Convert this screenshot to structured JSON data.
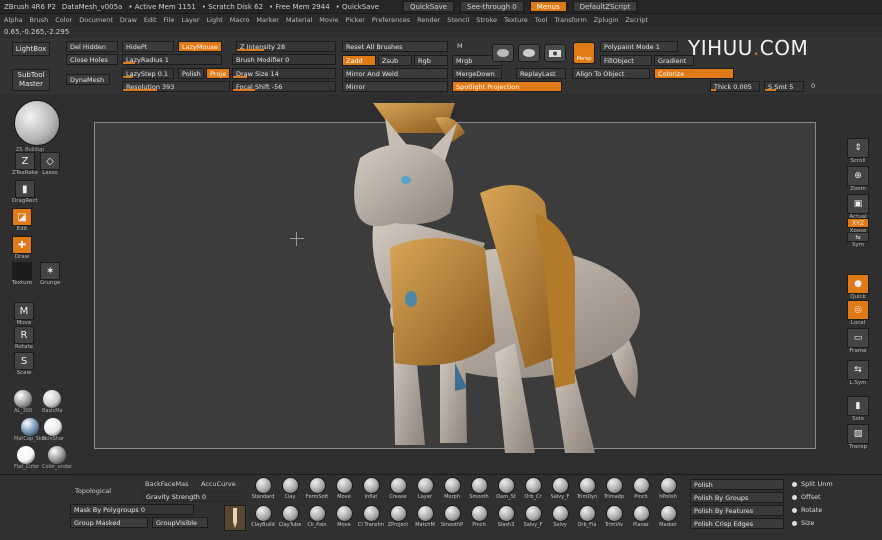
{
  "titlebar": {
    "app": "ZBrush 4R6 P2",
    "doc": "DataMesh_v005a",
    "active_mem": "• Active Mem 1151",
    "scratch": "• Scratch Disk 62",
    "free_mem": "• Free Mem 2944",
    "quicksave_label": "• QuickSave",
    "quicksave_btn": "QuickSave",
    "see_through": "See-through  0",
    "menus_btn": "Menus",
    "default_script": "DefaultZScript"
  },
  "menubar": [
    "Alpha",
    "Brush",
    "Color",
    "Document",
    "Draw",
    "Edit",
    "File",
    "Layer",
    "Light",
    "Macro",
    "Marker",
    "Material",
    "Movie",
    "Picker",
    "Preferences",
    "Render",
    "Stencil",
    "Stroke",
    "Texture",
    "Tool",
    "Transform",
    "Zplugin",
    "Zscript"
  ],
  "coords": "0.65,-0.265,-2.295",
  "watermark": {
    "pre": "YIHUU",
    "dot": ".",
    "post": "COM"
  },
  "shelf": {
    "lightbox": "LightBox",
    "subtool_master": "SubTool Master",
    "del_hidden": "Del Hidden",
    "close_holes": "Close Holes",
    "dynamesh": "DynaMesh",
    "hidept": "HidePt",
    "lazymouse": "LazyMouse",
    "lazyradius": "LazyRadius 1",
    "lazystep": "LazyStep 0.1",
    "polish": "Polish",
    "projection": "Proje",
    "resolution": "Resolution 393",
    "z_intensity": "Z Intensity 28",
    "brush_modifier": "Brush Modifier 0",
    "draw_size": "Draw Size 14",
    "focal_shift": "Focal Shift -56",
    "reset_all": "Reset All Brushes",
    "zadd": "Zadd",
    "zsub": "Zsub",
    "rgb": "Rgb",
    "mrgb": "Mrgb",
    "m": "M",
    "mirror_weld": "Mirror And Weld",
    "mergedown": "MergeDown",
    "mirror": "Mirror",
    "replaylast": "ReplayLast",
    "spotlight": "Spotlight Projection",
    "persp": "Persp",
    "polypaint_mode": "Polypaint Mode 1",
    "fillobject": "FillObject",
    "gradient": "Gradient",
    "align_object": "Align To Object",
    "colorize": "Colorize",
    "thick": "Thick 0.005",
    "s_smt": "S Smt 5",
    "s_smt_val": "0",
    "icons": [
      "Scroll",
      "Rotate",
      "Snapshot"
    ]
  },
  "left": {
    "brush_label": "ZS_Buildup",
    "tools": [
      {
        "label": "ZTexRake",
        "glyph": "Z"
      },
      {
        "label": "Lasso",
        "glyph": "◇"
      },
      {
        "label": "DragRect",
        "glyph": "▮"
      },
      {
        "label": "Edit",
        "glyph": "◪"
      },
      {
        "label": "Draw",
        "glyph": "✚"
      },
      {
        "label": "Texture",
        "glyph": ""
      },
      {
        "label": "Grunge",
        "glyph": "✶"
      },
      {
        "label": "Move",
        "glyph": "M"
      },
      {
        "label": "Rotate",
        "glyph": "R"
      },
      {
        "label": "Scale",
        "glyph": "S"
      }
    ],
    "materials": [
      {
        "label": "AL_300",
        "color": "#9a9a9a"
      },
      {
        "label": "BasicMa",
        "color": "#c9c9c9"
      },
      {
        "label": "MatCap_Skin",
        "color": "#6a8fb0"
      },
      {
        "label": "SkinShar",
        "color": "#e8e8e8"
      },
      {
        "label": "Flat_Color",
        "color": "#f5f5f5"
      },
      {
        "label": "Color_under",
        "color": "#8f8f8f"
      }
    ],
    "swatch_primary": "#e6c790",
    "swatch_secondary": "#e6e6e6"
  },
  "right": {
    "tools": [
      {
        "label": "Scroll",
        "glyph": "⇕"
      },
      {
        "label": "Zoom",
        "glyph": "⊕"
      },
      {
        "label": "Actual",
        "glyph": "▣"
      },
      {
        "label": "Xpose",
        "glyph": "XYZ"
      },
      {
        "label": "Sym",
        "glyph": "⇆"
      },
      {
        "label": "Quick",
        "glyph": "●"
      },
      {
        "label": "Local",
        "glyph": "◎"
      },
      {
        "label": "Frame",
        "glyph": "▭"
      },
      {
        "label": "L.Sym",
        "glyph": "⇆"
      },
      {
        "label": "Solo",
        "glyph": "▮"
      },
      {
        "label": "Transp",
        "glyph": "▧"
      }
    ]
  },
  "bottom": {
    "topological": "Topological",
    "backface": "BackFaceMas",
    "accucurve": "AccuCurve",
    "gravity": "Gravity Strength 0",
    "mask_polygroups": "Mask By Polygroups 0",
    "group_masked": "Group Masked",
    "group_visible": "GroupVisible",
    "brushes_row1": [
      "Standard",
      "Clay",
      "FormSoft",
      "Move",
      "Inflat",
      "Crease",
      "Layer",
      "Morph",
      "Smooth",
      "Dam_St",
      "Orb_Cr",
      "Salvy_F",
      "TrimDyn",
      "Trimadp",
      "Pinch",
      "hPolish"
    ],
    "brushes_row2": [
      "ClayBuild",
      "ClayTube",
      "Cli_Pain",
      "Move",
      "Cl Transfm",
      "ZProject",
      "MatchM",
      "SmoothP",
      "Pinch",
      "Slash3",
      "Salvy_F",
      "Salvy",
      "Orb_Fla",
      "TrimViv",
      "Planar",
      "Masker"
    ],
    "polish": "Polish",
    "polish_groups": "Polish By Groups",
    "polish_features": "Polish By Features",
    "polish_crisp": "Polish Crisp Edges",
    "split_unmasked": "Split Unm",
    "offset": "Offset",
    "rotate": "Rotate",
    "size": "Size"
  }
}
